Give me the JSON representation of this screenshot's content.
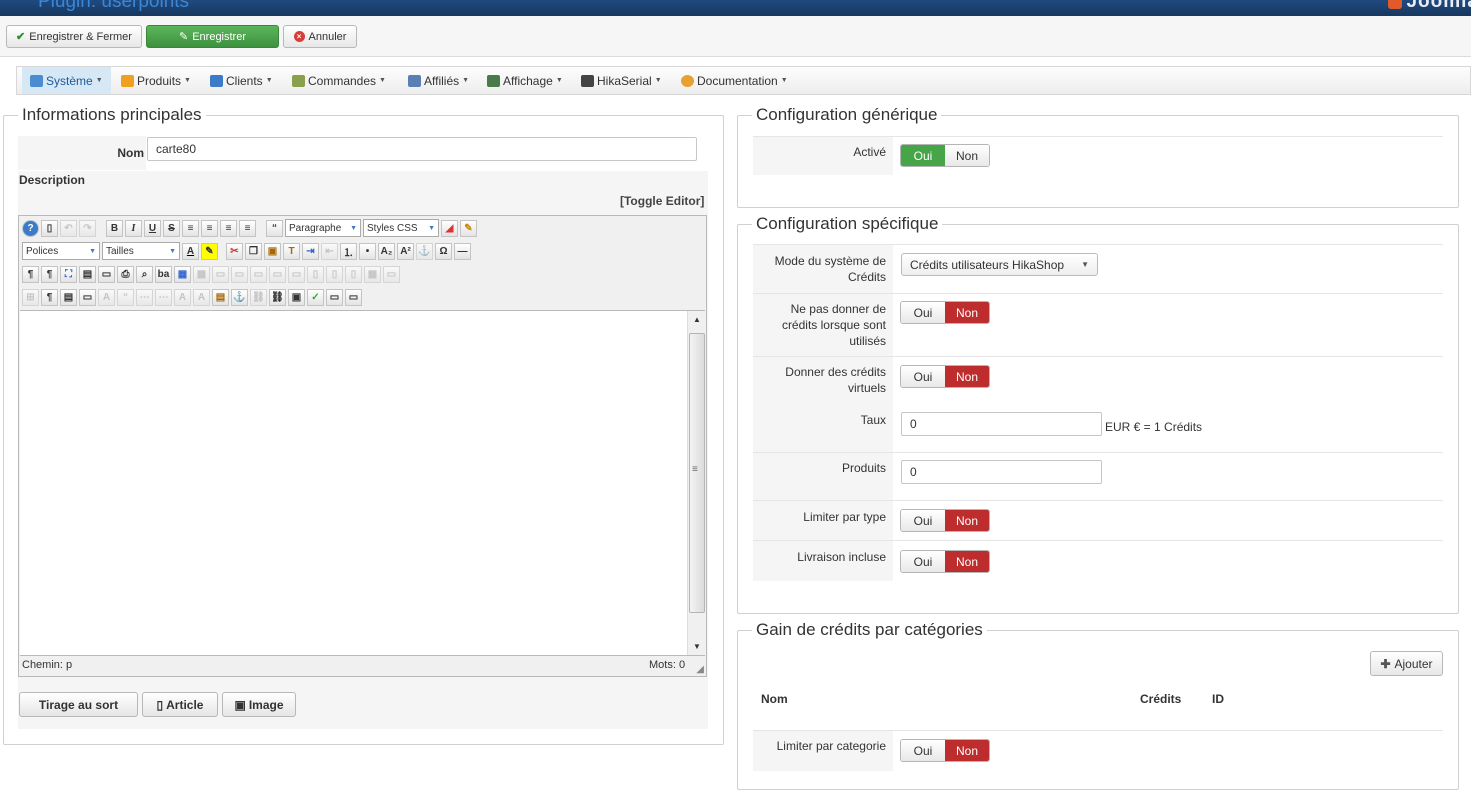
{
  "window": {
    "title": "Plugin: userpoints",
    "logo_text": "Joomla"
  },
  "toolbar": {
    "save_close": "Enregistrer & Fermer",
    "save": "Enregistrer",
    "cancel": "Annuler"
  },
  "menu": [
    {
      "label": "Système",
      "icon": "wrench-icon",
      "color": "#4b8bd0"
    },
    {
      "label": "Produits",
      "icon": "box-icon",
      "color": "#f0a020"
    },
    {
      "label": "Clients",
      "icon": "users-icon",
      "color": "#3b7bc8"
    },
    {
      "label": "Commandes",
      "icon": "orders-icon",
      "color": "#8aa04a"
    },
    {
      "label": "Affiliés",
      "icon": "affiliates-icon",
      "color": "#5a7fb5"
    },
    {
      "label": "Affichage",
      "icon": "display-icon",
      "color": "#4a7a4a"
    },
    {
      "label": "HikaSerial",
      "icon": "serial-icon",
      "color": "#444444"
    },
    {
      "label": "Documentation",
      "icon": "help-icon",
      "color": "#e8a030"
    }
  ],
  "main": {
    "legend": "Informations principales",
    "name_label": "Nom",
    "name_value": "carte80",
    "description_label": "Description",
    "toggle_editor": "[Toggle Editor]",
    "editor": {
      "paragraph_select": "Paragraphe",
      "styles_select": "Styles CSS",
      "fonts_select": "Polices",
      "sizes_select": "Tailles",
      "path": "Chemin: p",
      "words": "Mots: 0"
    },
    "buttons": {
      "random": "Tirage au sort",
      "article": "Article",
      "image": "Image"
    }
  },
  "generic": {
    "legend": "Configuration générique",
    "active_label": "Activé",
    "yes": "Oui",
    "no": "Non"
  },
  "specific": {
    "legend": "Configuration spécifique",
    "mode_label": "Mode du système de Crédits",
    "mode_value": "Crédits utilisateurs HikaShop",
    "no_credits_label": "Ne pas donner de crédits lorsque sont utilisés",
    "virtual_label": "Donner des crédits virtuels",
    "rate_label": "Taux",
    "rate_value": "0",
    "rate_suffix": "EUR € = 1 Crédits",
    "products_label": "Produits",
    "products_value": "0",
    "limit_type_label": "Limiter par type",
    "shipping_label": "Livraison incluse",
    "yes": "Oui",
    "no": "Non"
  },
  "categories": {
    "legend": "Gain de crédits par catégories",
    "add_button": "Ajouter",
    "columns": [
      "Nom",
      "Crédits",
      "ID"
    ],
    "limit_label": "Limiter par categorie",
    "yes": "Oui",
    "no": "Non"
  }
}
